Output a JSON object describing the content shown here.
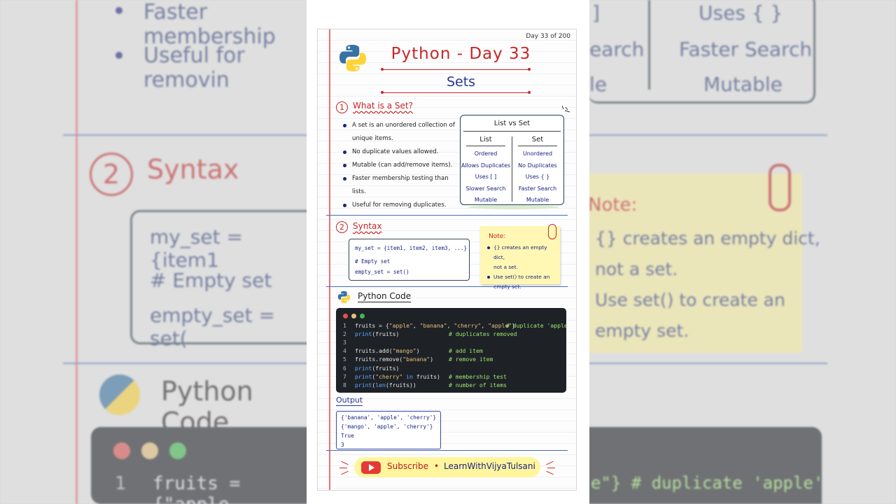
{
  "header": {
    "day_count": "Day 33 of 200",
    "title": "Python - Day 33",
    "subtitle": "Sets"
  },
  "section1": {
    "number": "1",
    "title": "What is a Set?",
    "bullets": [
      [
        "A set is an unordered collection of",
        "unique items."
      ],
      [
        "No duplicate values allowed."
      ],
      [
        "Mutable (can add/remove items)."
      ],
      [
        "Faster membership testing than lists."
      ],
      [
        "Useful for removing duplicates."
      ]
    ],
    "comparison": {
      "title": "List vs Set",
      "list_header": "List",
      "set_header": "Set",
      "list_items": [
        "Ordered",
        "Allows Duplicates",
        "Uses [ ]",
        "Slower Search",
        "Mutable"
      ],
      "set_items": [
        "Unordered",
        "No Duplicates",
        "Uses { }",
        "Faster Search",
        "Mutable"
      ]
    }
  },
  "section2": {
    "number": "2",
    "title": "Syntax",
    "code_lines": [
      "my_set = {item1, item2, item3, ...}",
      "# Empty set",
      "empty_set = set()"
    ],
    "note": {
      "title": "Note:",
      "items": [
        [
          "{} creates an empty dict,",
          "not a set."
        ],
        [
          "Use set() to create an",
          "empty set."
        ]
      ]
    }
  },
  "python_code": {
    "title": "Python Code",
    "lines": [
      {
        "n": "1",
        "code": "fruits = {\"apple\", \"banana\", \"cherry\", \"apple\"}",
        "comment": "# duplicate 'apple'"
      },
      {
        "n": "2",
        "code": "print(fruits)",
        "comment": "# duplicates removed"
      },
      {
        "n": "3",
        "code": "",
        "comment": ""
      },
      {
        "n": "4",
        "code": "fruits.add(\"mango\")",
        "comment": "# add item"
      },
      {
        "n": "5",
        "code": "fruits.remove(\"banana\")",
        "comment": "# remove item"
      },
      {
        "n": "6",
        "code": "print(fruits)",
        "comment": ""
      },
      {
        "n": "7",
        "code": "print(\"cherry\" in fruits)",
        "comment": "# membership test"
      },
      {
        "n": "8",
        "code": "print(len(fruits))",
        "comment": "# number of items"
      }
    ]
  },
  "output": {
    "title": "Output",
    "lines": [
      "{'banana', 'apple', 'cherry'}",
      "{'mango', 'apple', 'cherry'}",
      "True",
      "3"
    ]
  },
  "subscribe": {
    "label": "Subscribe",
    "separator": "•",
    "channel": "LearnWithVijyaTulsani"
  },
  "background": {
    "left_lines": [
      "Faster membership",
      "Useful for removin",
      "Syntax",
      "my_set = {item1",
      "# Empty set",
      "empty_set = set(",
      "Python Code",
      "fruits = {\"apple"
    ],
    "right_lines": [
      "Uses { }",
      "earch",
      "Faster Search",
      "le",
      "Mutable",
      "Note:",
      "{} creates an empty dict,",
      "not a set.",
      "Use set() to create an",
      "empty set.",
      "e\"} # duplicate 'apple'"
    ],
    "bg_num": "2",
    "bg_line_num": "1",
    "bg_bracket": "]"
  },
  "colors": {
    "accent_red": "#c62828",
    "navy": "#1a237e",
    "editor_bg": "#1e2227",
    "note_yellow": "#fff7b3"
  }
}
